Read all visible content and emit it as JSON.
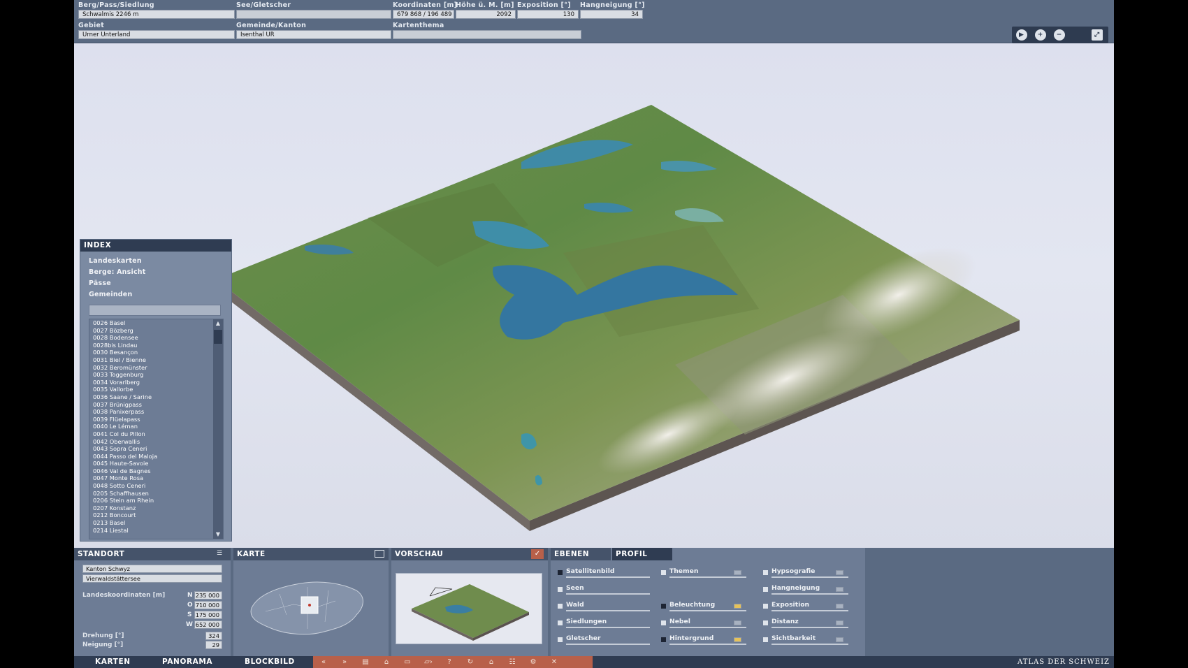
{
  "top": {
    "labels": {
      "berg": "Berg/Pass/Siedlung",
      "see": "See/Gletscher",
      "koord": "Koordinaten [m]",
      "hoehe": "Höhe ü. M. [m]",
      "expo": "Exposition [°]",
      "hang": "Hangneigung [°]",
      "gebiet": "Gebiet",
      "gemeinde": "Gemeinde/Kanton",
      "thema": "Kartenthema"
    },
    "values": {
      "berg": "Schwalmis   2246 m",
      "see": "",
      "koord": "679 868 / 196 489",
      "hoehe": "2092",
      "expo": "130",
      "hang": "34",
      "gebiet": "Urner Unterland",
      "gemeinde": "Isenthal   UR",
      "thema": ""
    }
  },
  "index": {
    "title": "INDEX",
    "categories": [
      "Landeskarten",
      "Berge: Ansicht",
      "Pässe",
      "Gemeinden"
    ],
    "search_value": "",
    "items": [
      "0026 Basel",
      "0027 Bözberg",
      "0028 Bodensee",
      "0028bis Lindau",
      "0030 Besançon",
      "0031 Biel / Bienne",
      "0032 Beromünster",
      "0033 Toggenburg",
      "0034 Vorarlberg",
      "0035 Vallorbe",
      "0036 Saane / Sarine",
      "0037 Brünigpass",
      "0038 Panixerpass",
      "0039 Flüelapass",
      "0040 Le Léman",
      "0041 Col du Pillon",
      "0042 Oberwallis",
      "0043 Sopra Ceneri",
      "0044 Passo del Maloja",
      "0045 Haute-Savoie",
      "0046 Val de Bagnes",
      "0047 Monte Rosa",
      "0048 Sotto Ceneri",
      "0205 Schaffhausen",
      "0206 Stein am Rhein",
      "0207 Konstanz",
      "0212 Boncourt",
      "0213 Basel",
      "0214 Liestal"
    ]
  },
  "standort": {
    "title": "STANDORT",
    "field1": "Kanton Schwyz",
    "field2": "Vierwaldstättersee",
    "koord_label": "Landeskoordinaten [m]",
    "N": "235 000",
    "O": "710 000",
    "S": "175 000",
    "W": "652 000",
    "drehung_label": "Drehung [°]",
    "drehung": "324",
    "neigung_label": "Neigung [°]",
    "neigung": "29",
    "letters": {
      "n": "N",
      "o": "O",
      "s": "S",
      "w": "W"
    }
  },
  "karte": {
    "title": "KARTE"
  },
  "vorschau": {
    "title": "VORSCHAU"
  },
  "ebenen": {
    "tab1": "EBENEN",
    "tab2": "PROFIL",
    "col1": [
      "Satellitenbild",
      "Seen",
      "Wald",
      "Siedlungen",
      "Gletscher"
    ],
    "col2": [
      "Themen",
      "Beleuchtung",
      "Nebel",
      "Hintergrund"
    ],
    "col3": [
      "Hypsografie",
      "Hangneigung",
      "Exposition",
      "Distanz",
      "Sichtbarkeit"
    ]
  },
  "footer": {
    "tabs": [
      "KARTEN",
      "PANORAMA",
      "BLOCKBILD"
    ],
    "brand": "ATLAS DER SCHWEIZ"
  },
  "colors": {
    "panel": "#5a6a82",
    "header": "#2f3c52",
    "toolstrip": "#b8604a"
  }
}
